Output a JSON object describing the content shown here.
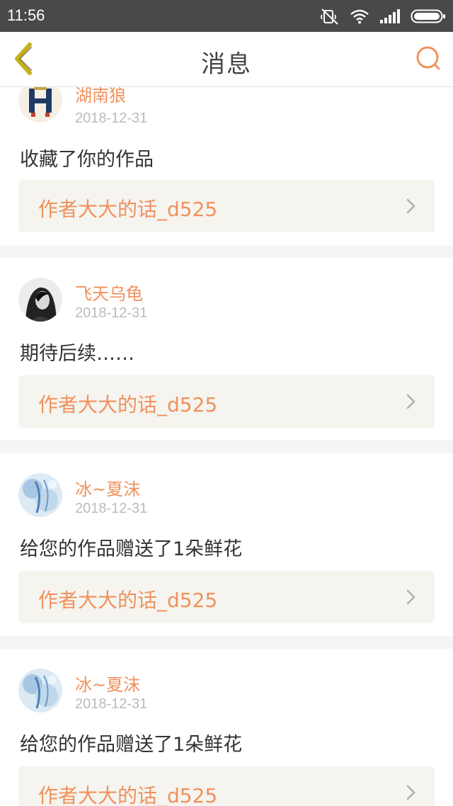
{
  "status_bar": {
    "time": "11:56",
    "icons": [
      "mute-icon",
      "wifi-icon",
      "signal-icon",
      "battery-icon"
    ]
  },
  "header": {
    "title": "消息",
    "back_icon": "chevron-left-icon",
    "search_icon": "search-icon"
  },
  "colors": {
    "accent": "#f0915d",
    "back_arrow": "#c6b11c",
    "status_bar": "#494949",
    "link_bg": "#f5f4ef"
  },
  "messages": [
    {
      "username": "湖南狼",
      "date": "2018-12-31",
      "text": "收藏了你的作品",
      "work_title": "作者大大的话_d525"
    },
    {
      "username": "飞天乌龟",
      "date": "2018-12-31",
      "text": "期待后续……",
      "work_title": "作者大大的话_d525"
    },
    {
      "username": "冰~夏沫",
      "date": "2018-12-31",
      "text": "给您的作品赠送了1朵鲜花",
      "work_title": "作者大大的话_d525"
    },
    {
      "username": "冰~夏沫",
      "date": "2018-12-31",
      "text": "给您的作品赠送了1朵鲜花",
      "work_title": "作者大大的话_d525"
    }
  ]
}
